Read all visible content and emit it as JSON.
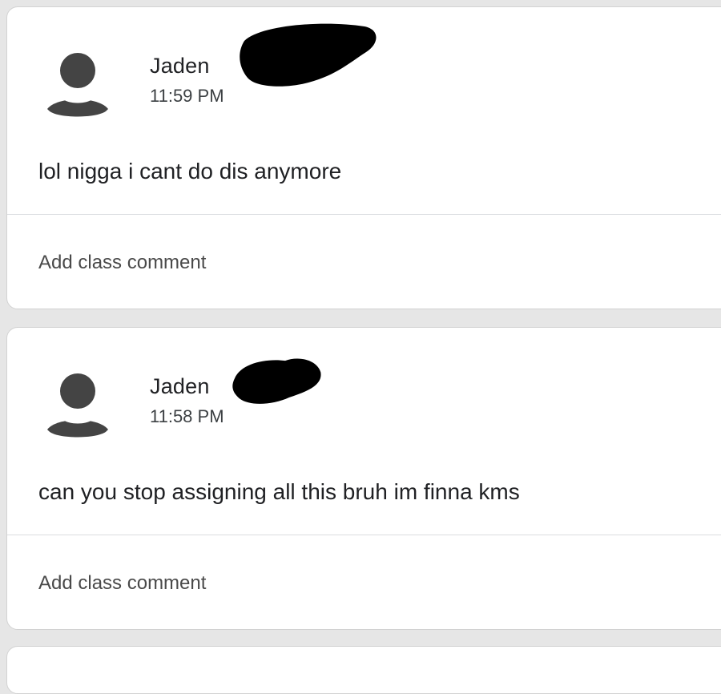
{
  "posts": [
    {
      "author": "Jaden",
      "time": "11:59 PM",
      "text": "lol nigga i cant do dis anymore",
      "comment_placeholder": "Add class comment"
    },
    {
      "author": "Jaden",
      "time": "11:58 PM",
      "text": "can you stop assigning all this bruh im finna kms",
      "comment_placeholder": "Add class comment"
    }
  ],
  "icons": {
    "avatar": "account-circle-icon",
    "redaction": "black-scribble"
  },
  "colors": {
    "background": "#e6e6e6",
    "card": "#ffffff",
    "avatar": "#444444",
    "divider": "#dadce0"
  }
}
